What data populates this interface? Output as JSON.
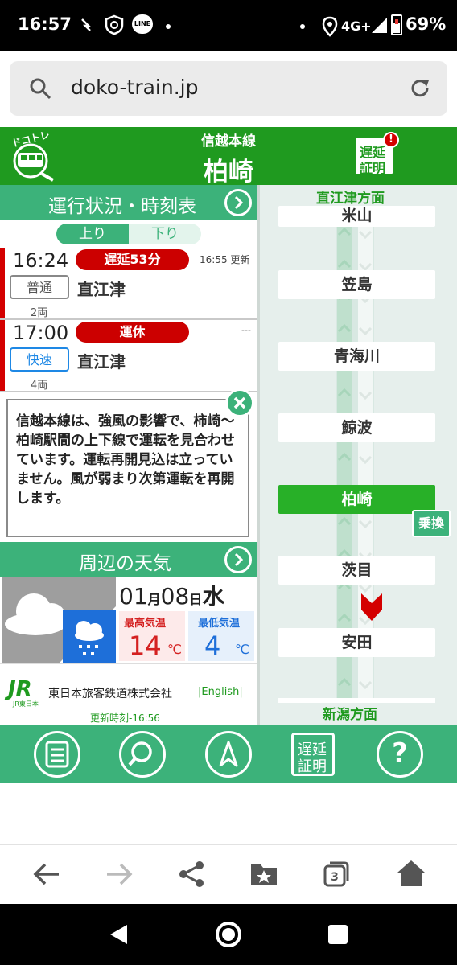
{
  "status_bar": {
    "time": "16:57",
    "network": "4G+",
    "battery": "69%"
  },
  "browser": {
    "url": "doko-train.jp"
  },
  "site": {
    "logo_text": "ドコトレ",
    "line_name": "信越本線",
    "station_name": "柏崎",
    "delay_cert_label_1": "遅延",
    "delay_cert_label_2": "証明",
    "delay_cert_badge": "!"
  },
  "schedule": {
    "section_title": "運行状況・時刻表",
    "tab_up": "上り",
    "tab_down": "下り",
    "trains": [
      {
        "time": "16:24",
        "status": "遅延53分",
        "updated": "16:55 更新",
        "type": "普通",
        "destination": "直江津",
        "cars": "2両"
      },
      {
        "time": "17:00",
        "status": "運休",
        "updated": "---",
        "type": "快速",
        "destination": "直江津",
        "cars": "4両"
      }
    ]
  },
  "alert": {
    "message": "信越本線は、強風の影響で、柿崎～柏崎駅間の上下線で運転を見合わせています。運転再開見込は立っていません。風が弱まり次第運転を再開します。"
  },
  "weather": {
    "section_title": "周辺の天気",
    "month": "01",
    "month_unit": "月",
    "day": "08",
    "day_unit": "日",
    "weekday": "水",
    "high_label": "最高気温",
    "high_value": "14",
    "low_label": "最低気温",
    "low_value": "4",
    "unit": "℃"
  },
  "footer": {
    "jr_logo": "JR",
    "jr_sub": "JR東日本",
    "company": "東日本旅客鉄道株式会社",
    "english_link": "|English|",
    "updated": "更新時刻-16:56"
  },
  "route": {
    "top_direction": "直江津方面",
    "bottom_direction": "新潟方面",
    "stations": [
      "米山",
      "笠島",
      "青海川",
      "鯨波",
      "柏崎",
      "茨目",
      "安田"
    ],
    "current_station_index": 4,
    "transfer_label": "乗換"
  },
  "bottom_nav": {
    "items": [
      "menu-icon",
      "search-icon",
      "compass-icon",
      "delay-certificate",
      "help-icon"
    ],
    "delay_cert_1": "遅延",
    "delay_cert_2": "証明",
    "help": "?"
  },
  "colors": {
    "header_green": "#1f9a1f",
    "section_green": "#3cb27a",
    "delay_red": "#cc0000",
    "current_station": "#28b028"
  }
}
